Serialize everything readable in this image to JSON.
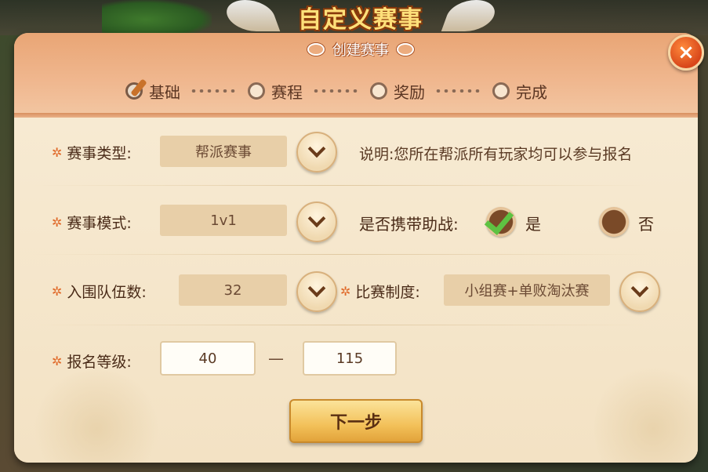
{
  "header": {
    "title": "自定义赛事",
    "subtitle": "创建赛事"
  },
  "steps": [
    {
      "label": "基础",
      "active": true
    },
    {
      "label": "赛程",
      "active": false
    },
    {
      "label": "奖励",
      "active": false
    },
    {
      "label": "完成",
      "active": false
    }
  ],
  "form": {
    "match_type": {
      "label": "赛事类型:",
      "value": "帮派赛事",
      "note": "说明:您所在帮派所有玩家均可以参与报名"
    },
    "match_mode": {
      "label": "赛事模式:",
      "value": "1v1"
    },
    "assist": {
      "label": "是否携带助战:",
      "yes": "是",
      "no": "否",
      "selected": "是"
    },
    "team_count": {
      "label": "入围队伍数:",
      "value": "32"
    },
    "format": {
      "label": "比赛制度:",
      "value": "小组赛+单败淘汰赛"
    },
    "level": {
      "label": "报名等级:",
      "min": "40",
      "separator": "—",
      "max": "115"
    }
  },
  "buttons": {
    "next": "下一步",
    "close": "×"
  },
  "colors": {
    "accent": "#e06a2a",
    "check": "#5ec242",
    "panel": "#f3e4c8"
  }
}
